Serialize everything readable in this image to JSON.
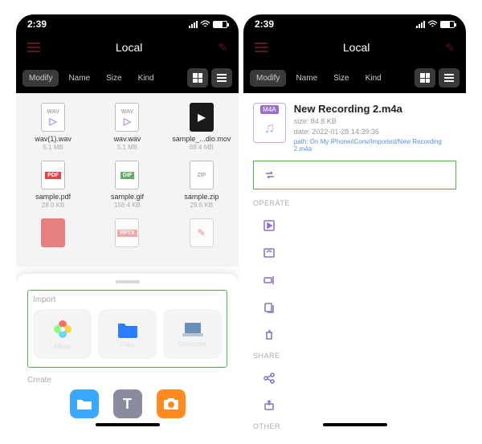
{
  "status": {
    "time": "2:39"
  },
  "nav": {
    "title": "Local"
  },
  "sortbar": {
    "modify": "Modify",
    "name": "Name",
    "size": "Size",
    "kind": "Kind"
  },
  "left": {
    "files": [
      {
        "ext": "WAV",
        "name": "wav(1).wav",
        "size": "5.1 MB"
      },
      {
        "ext": "WAV",
        "name": "wav.wav",
        "size": "5.1 MB"
      },
      {
        "ext": "",
        "name": "sample_...dio.mov",
        "size": "68.4 MB",
        "dark": true
      },
      {
        "ext": "PDF",
        "name": "sample.pdf",
        "size": "28.0 KB"
      },
      {
        "ext": "GIF",
        "name": "sample.gif",
        "size": "156.4 KB"
      },
      {
        "ext": "ZIP",
        "name": "sample.zip",
        "size": "29.6 KB"
      },
      {
        "ext": "",
        "name": "",
        "size": ""
      },
      {
        "ext": "PPTX",
        "name": "",
        "size": ""
      },
      {
        "ext": "",
        "name": "",
        "size": ""
      }
    ],
    "sheet": {
      "import_label": "Import",
      "import": {
        "album": "Album",
        "files": "Files",
        "computer": "Computer"
      },
      "create_label": "Create"
    }
  },
  "right": {
    "file": {
      "badge": "M4A",
      "title": "New Recording 2.m4a",
      "size_label": "size: 84.8 KB",
      "date_label": "date: 2022-01-28 14:39:36",
      "path_label": "path: On My iPhone/iConv/Imported/New Recording 2.m4a"
    },
    "sections": {
      "operate": "OPERATE",
      "share": "SHARE",
      "other": "OTHER"
    }
  }
}
